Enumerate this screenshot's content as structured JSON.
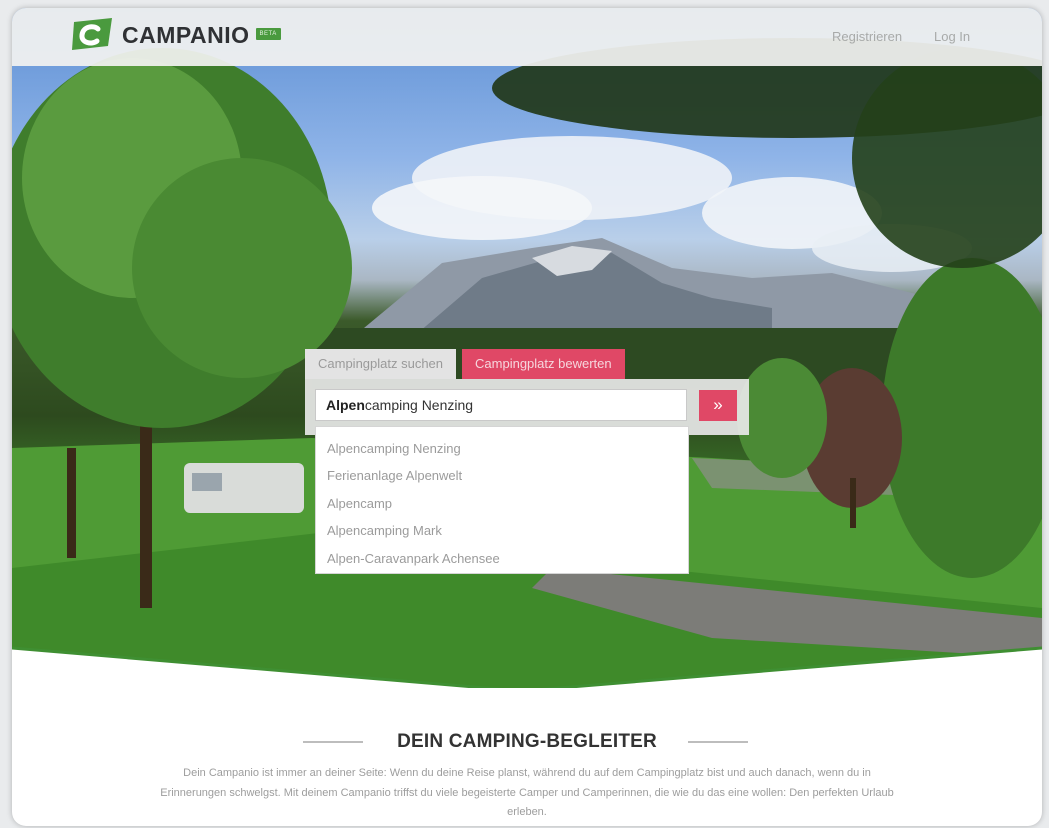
{
  "brand": {
    "name": "CAMPANIO",
    "badge": "BETA",
    "accent": "#4a9a3e",
    "pink": "#e04866"
  },
  "nav": {
    "register": "Registrieren",
    "login": "Log In"
  },
  "search": {
    "tabs": [
      "Campingplatz suchen",
      "Campingplatz bewerten"
    ],
    "active_tab": "Campingplatz bewerten",
    "query_bold": "Alpen",
    "query_rest": "camping Nenzing",
    "submit_icon": "double-chevron-right-icon",
    "submit_glyph": "»",
    "suggestions": [
      "Alpencamping Nenzing",
      "Ferienanlage Alpenwelt",
      "Alpencamp",
      "Alpencamping Mark",
      "Alpen-Caravanpark Achensee"
    ]
  },
  "intro": {
    "title": "DEIN CAMPING-BEGLEITER",
    "text": "Dein Campanio ist immer an deiner Seite: Wenn du deine Reise planst, während du auf dem Campingplatz bist und auch danach, wenn du in Erinnerungen schwelgst. Mit deinem Campanio triffst du viele begeisterte Camper und Camperinnen, die wie du das eine wollen: Den perfekten Urlaub erleben."
  }
}
